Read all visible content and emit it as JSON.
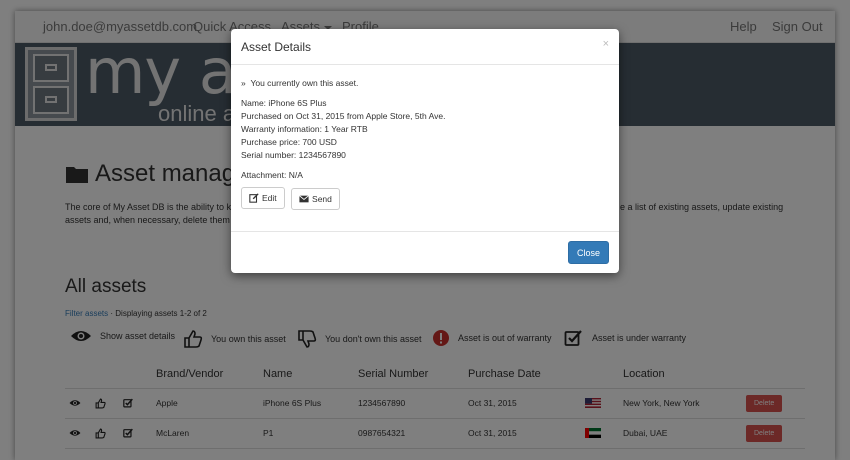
{
  "navbar": {
    "user_email": "john.doe@myassetdb.com",
    "quick_access": "Quick Access",
    "assets": "Assets",
    "profile": "Profile",
    "help": "Help",
    "sign_out": "Sign Out"
  },
  "banner": {
    "title": "my asse",
    "subtitle": "online asse"
  },
  "page": {
    "title": "Asset manage",
    "intro_line1_left": "The core of My Asset DB is the ability to k",
    "intro_line1_right": "e a list of existing assets, update existing",
    "intro_line2": "assets and, when necessary, delete them",
    "all_assets": "All assets",
    "filter_link": "Filter assets",
    "filter_sep": "·",
    "filter_text": "Displaying assets 1-2 of 2"
  },
  "legend": {
    "show_details": "Show asset details",
    "own": "You own this asset",
    "dont_own": "You don't own this asset",
    "out_of_warranty": "Asset is out of warranty",
    "under_warranty": "Asset is under warranty"
  },
  "table": {
    "headers": [
      "Brand/Vendor",
      "Name",
      "Serial Number",
      "Purchase Date",
      "Location"
    ],
    "rows": [
      {
        "brand": "Apple",
        "name": "iPhone 6S Plus",
        "serial": "1234567890",
        "date": "Oct 31, 2015",
        "location": "New York, New York",
        "delete": "Delete"
      },
      {
        "brand": "McLaren",
        "name": "P1",
        "serial": "0987654321",
        "date": "Oct 31, 2015",
        "location": "Dubai, UAE",
        "delete": "Delete"
      }
    ]
  },
  "modal": {
    "title": "Asset Details",
    "close_x": "×",
    "ownership_bullet": "»",
    "ownership": "You currently own this asset.",
    "name": "Name: iPhone 6S Plus",
    "purchased": "Purchased on Oct 31, 2015 from Apple Store, 5th Ave.",
    "warranty": "Warranty information: 1 Year RTB",
    "price": "Purchase price: 700 USD",
    "serial": "Serial number: 1234567890",
    "attachment": "Attachment: N/A",
    "edit": "Edit",
    "send": "Send",
    "close": "Close"
  },
  "colors": {
    "banner": "#4c5a66",
    "primary": "#337ab7",
    "danger": "#d9534f"
  }
}
